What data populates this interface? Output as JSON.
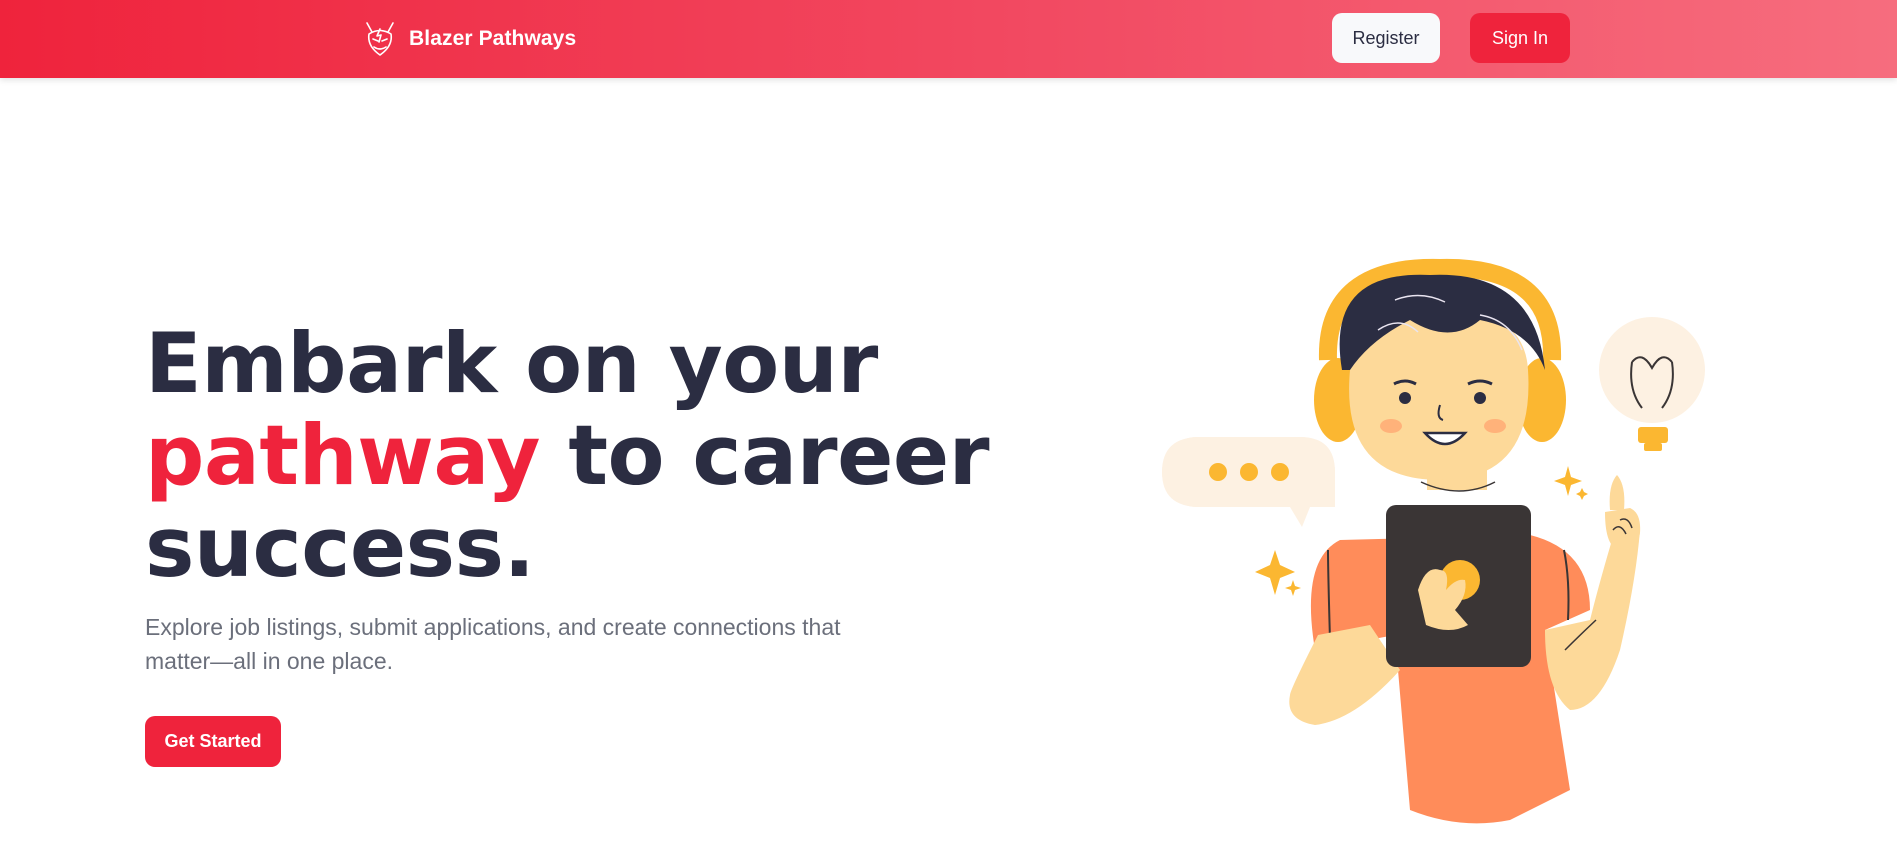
{
  "nav": {
    "brand_name": "Blazer Pathways",
    "logo_icon": "blazer-devil-logo-icon",
    "register_label": "Register",
    "signin_label": "Sign In"
  },
  "hero": {
    "title_line1": "Embark on your",
    "title_accent": "pathway",
    "title_rest": " to career",
    "title_line3": "success.",
    "subtitle": "Explore job listings, submit applications, and create connections that matter—all in one place.",
    "cta_label": "Get Started",
    "illustration": "person-with-tablet-illustration"
  },
  "colors": {
    "brand_red": "#ef233c",
    "navy_text": "#2b2d42",
    "muted_text": "#6b6f7b",
    "nav_gradient_end": "#f66d7e",
    "illustration_orange": "#ff8c5a",
    "illustration_yellow": "#fbb731",
    "skin": "#fdd999",
    "tablet_dark": "#3a3535",
    "bubble_cream": "#fdf1e2"
  }
}
